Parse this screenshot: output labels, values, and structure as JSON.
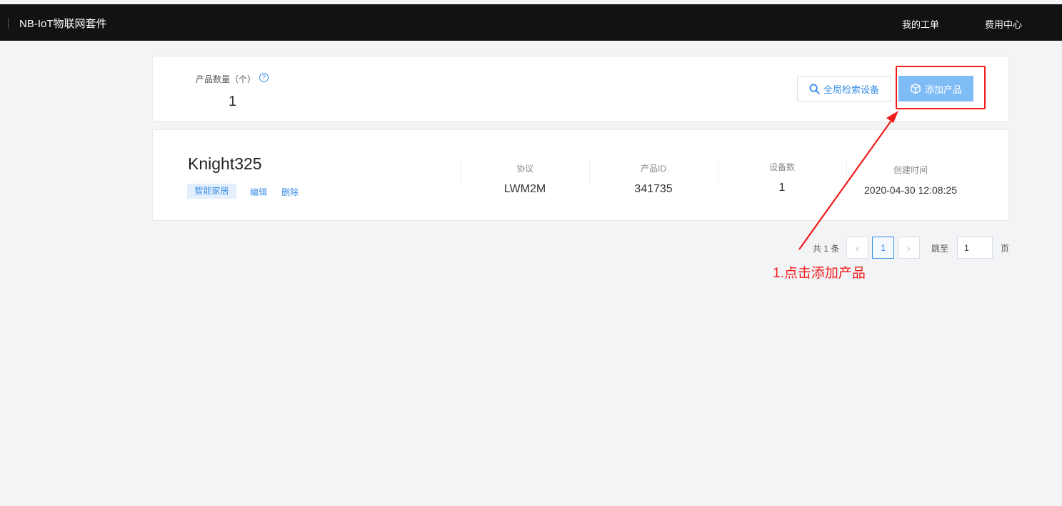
{
  "header": {
    "title": "NB-IoT物联网套件",
    "nav": [
      "我的工单",
      "费用中心"
    ]
  },
  "summary": {
    "label": "产品数量（个）",
    "help_icon": "?",
    "count": "1",
    "search_button": "全局检索设备",
    "add_button": "添加产品"
  },
  "product": {
    "name": "Knight325",
    "tag": "智能家居",
    "edit": "编辑",
    "delete": "删除",
    "columns": [
      {
        "label": "协议",
        "value": "LWM2M"
      },
      {
        "label": "产品ID",
        "value": "341735"
      },
      {
        "label": "设备数",
        "value": "1"
      },
      {
        "label": "创建时间",
        "value": "2020-04-30 12:08:25"
      }
    ]
  },
  "pagination": {
    "total": "共 1 条",
    "current": "1",
    "jump_label": "跳至",
    "jump_value": "1",
    "page_suffix": "页"
  },
  "annotation": {
    "text": "1.点击添加产品",
    "color": "#f21b1b"
  },
  "colors": {
    "topbar": "#121212",
    "accent": "#3a8ee6",
    "add_button": "#7fbbf5",
    "page_bg": "#f3f4f6"
  }
}
